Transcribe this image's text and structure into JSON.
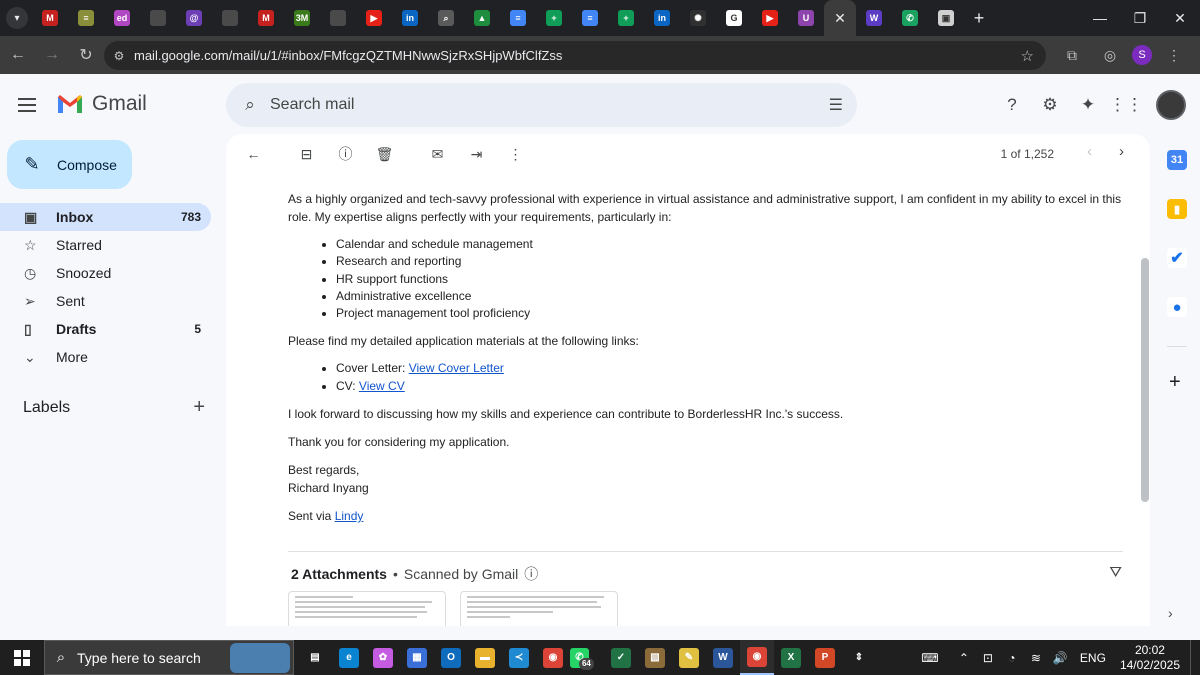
{
  "browser": {
    "tabs": [
      {
        "icon": "gmail-icon",
        "color": "#c5221f",
        "glyph": "M"
      },
      {
        "icon": "stack-icon",
        "color": "#8a8f3a",
        "glyph": "≡"
      },
      {
        "icon": "ed-icon",
        "color": "#b146c2",
        "glyph": "ed"
      },
      {
        "icon": "generic-icon",
        "color": "#4a4a4a",
        "glyph": ""
      },
      {
        "icon": "circle-logo-icon",
        "color": "#6c3fb5",
        "glyph": "@"
      },
      {
        "icon": "generic-icon",
        "color": "#4a4a4a",
        "glyph": ""
      },
      {
        "icon": "gmail-icon",
        "color": "#c5221f",
        "glyph": "M"
      },
      {
        "icon": "3m-icon",
        "color": "#3a7a1a",
        "glyph": "3M"
      },
      {
        "icon": "generic-icon",
        "color": "#4a4a4a",
        "glyph": ""
      },
      {
        "icon": "youtube-icon",
        "color": "#e62117",
        "glyph": "▶"
      },
      {
        "icon": "linkedin-icon",
        "color": "#0a66c2",
        "glyph": "in"
      },
      {
        "icon": "search-icon",
        "color": "#5a5a5a",
        "glyph": "⌕"
      },
      {
        "icon": "drive-icon",
        "color": "#1e8e3e",
        "glyph": "▲"
      },
      {
        "icon": "docs-icon",
        "color": "#4285f4",
        "glyph": "≡"
      },
      {
        "icon": "sheets-icon",
        "color": "#0f9d58",
        "glyph": "+"
      },
      {
        "icon": "docs-icon",
        "color": "#4285f4",
        "glyph": "≡"
      },
      {
        "icon": "sheets-icon",
        "color": "#0f9d58",
        "glyph": "+"
      },
      {
        "icon": "linkedin-icon",
        "color": "#0a66c2",
        "glyph": "in"
      },
      {
        "icon": "openai-icon",
        "color": "#303030",
        "glyph": "✺"
      },
      {
        "icon": "google-icon",
        "color": "#ffffff",
        "glyph": "G"
      },
      {
        "icon": "music-icon",
        "color": "#e62117",
        "glyph": "▶"
      },
      {
        "icon": "u-icon",
        "color": "#8e44ad",
        "glyph": "U"
      }
    ],
    "tabs_after": [
      {
        "icon": "wave-icon",
        "color": "#5b3cc4",
        "glyph": "W"
      },
      {
        "icon": "phone-icon",
        "color": "#1aa260",
        "glyph": "✆"
      },
      {
        "icon": "window-icon",
        "color": "#d0d0d0",
        "glyph": "▣"
      }
    ],
    "url": "mail.google.com/mail/u/1/#inbox/FMfcgzQZTMHNwwSjzRxSHjpWbfClfZss",
    "profile_initial": "S"
  },
  "gmail": {
    "logo_text": "Gmail",
    "search_placeholder": "Search mail",
    "compose_label": "Compose",
    "nav": [
      {
        "key": "inbox",
        "icon": "inbox-icon",
        "glyph": "▣",
        "label": "Inbox",
        "count": "783",
        "active": true,
        "bold": true
      },
      {
        "key": "starred",
        "icon": "star-icon",
        "glyph": "☆",
        "label": "Starred",
        "count": ""
      },
      {
        "key": "snoozed",
        "icon": "clock-icon",
        "glyph": "◷",
        "label": "Snoozed",
        "count": ""
      },
      {
        "key": "sent",
        "icon": "send-icon",
        "glyph": "➢",
        "label": "Sent",
        "count": ""
      },
      {
        "key": "drafts",
        "icon": "draft-icon",
        "glyph": "▯",
        "label": "Drafts",
        "count": "5",
        "bold": true
      },
      {
        "key": "more",
        "icon": "chevron-down-icon",
        "glyph": "⌄",
        "label": "More",
        "count": ""
      }
    ],
    "labels_title": "Labels",
    "pager": "1 of 1,252"
  },
  "email": {
    "para1": "As a highly organized and tech-savvy professional with experience in virtual assistance and administrative support, I am confident in my ability to excel in this role. My expertise aligns perfectly with your requirements, particularly in:",
    "skills": [
      "Calendar and schedule management",
      "Research and reporting",
      "HR support functions",
      "Administrative excellence",
      "Project management tool proficiency"
    ],
    "para2": "Please find my detailed application materials at the following links:",
    "links": [
      {
        "prefix": "Cover Letter: ",
        "link": "View Cover Letter"
      },
      {
        "prefix": "CV: ",
        "link": "View CV"
      }
    ],
    "para3": "I look forward to discussing how my skills and experience can contribute to BorderlessHR Inc.'s success.",
    "para4": "Thank you for considering my application.",
    "closing": "Best regards,",
    "signature": "Richard Inyang",
    "sent_via_prefix": "Sent via ",
    "sent_via_link": "Lindy",
    "attachments_count": "2 Attachments",
    "attachments_dot": "•",
    "scanned": "Scanned by Gmail"
  },
  "taskbar": {
    "search_placeholder": "Type here to search",
    "lang": "ENG",
    "time": "20:02",
    "date": "14/02/2025",
    "badge": "64"
  }
}
